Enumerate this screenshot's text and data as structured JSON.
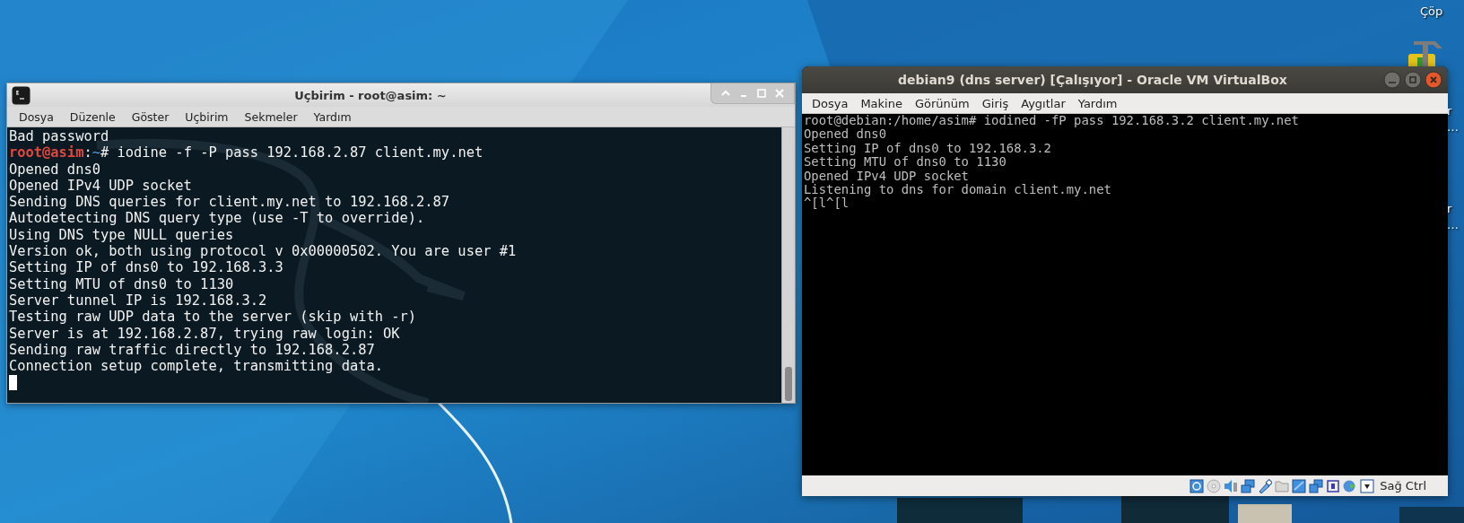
{
  "desktop": {
    "trash_label": "Çöp",
    "hidden_labels": [
      {
        "text": "r"
      },
      {
        "text": "…"
      },
      {
        "text": "r"
      },
      {
        "text": "…"
      }
    ]
  },
  "terminal_window": {
    "title": "Uçbirim - root@asim: ~",
    "menu": [
      "Dosya",
      "Düzenle",
      "Göster",
      "Uçbirim",
      "Sekmeler",
      "Yardım"
    ],
    "lines": [
      {
        "kind": "output",
        "text": "Bad password"
      },
      {
        "kind": "prompt",
        "user": "root@asim",
        "separator": ":",
        "path": "~",
        "command": "# iodine -f -P pass 192.168.2.87 client.my.net"
      },
      {
        "kind": "output",
        "text": "Opened dns0"
      },
      {
        "kind": "output",
        "text": "Opened IPv4 UDP socket"
      },
      {
        "kind": "output",
        "text": "Sending DNS queries for client.my.net to 192.168.2.87"
      },
      {
        "kind": "output",
        "text": "Autodetecting DNS query type (use -T to override)."
      },
      {
        "kind": "output",
        "text": "Using DNS type NULL queries"
      },
      {
        "kind": "output",
        "text": "Version ok, both using protocol v 0x00000502. You are user #1"
      },
      {
        "kind": "output",
        "text": "Setting IP of dns0 to 192.168.3.3"
      },
      {
        "kind": "output",
        "text": "Setting MTU of dns0 to 1130"
      },
      {
        "kind": "output",
        "text": "Server tunnel IP is 192.168.3.2"
      },
      {
        "kind": "output",
        "text": "Testing raw UDP data to the server (skip with -r)"
      },
      {
        "kind": "output",
        "text": "Server is at 192.168.2.87, trying raw login: OK"
      },
      {
        "kind": "output",
        "text": "Sending raw traffic directly to 192.168.2.87"
      },
      {
        "kind": "output",
        "text": "Connection setup complete, transmitting data."
      }
    ],
    "cursor": true
  },
  "vm_window": {
    "title": "debian9 (dns server) [Çalışıyor] - Oracle VM VirtualBox",
    "menu": [
      "Dosya",
      "Makine",
      "Görünüm",
      "Giriş",
      "Aygıtlar",
      "Yardım"
    ],
    "lines": [
      "root@debian:/home/asim# iodined -fP pass 192.168.3.2 client.my.net",
      "Opened dns0",
      "Setting IP of dns0 to 192.168.3.2",
      "Setting MTU of dns0 to 1130",
      "Opened IPv4 UDP socket",
      "Listening to dns for domain client.my.net",
      "^[l^[l"
    ],
    "status_bar": {
      "host_key": "Sağ Ctrl"
    }
  }
}
